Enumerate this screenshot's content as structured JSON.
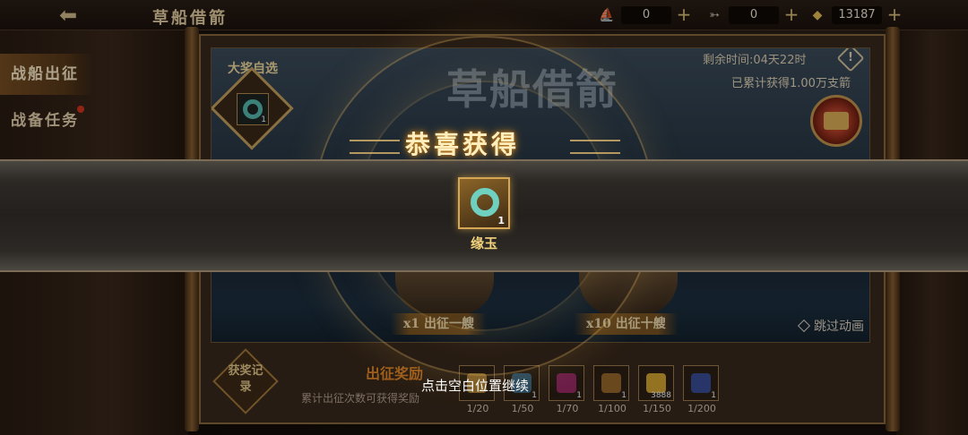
{
  "header": {
    "title": "草船借箭",
    "resources": [
      {
        "icon": "boat-icon",
        "value": "0"
      },
      {
        "icon": "arrow-bundle-icon",
        "value": "0"
      },
      {
        "icon": "gold-ingot-icon",
        "value": "13187"
      }
    ]
  },
  "sidebar": {
    "tabs": [
      {
        "label": "战船出征",
        "selected": true
      },
      {
        "label": "战备任务",
        "selected": false
      }
    ]
  },
  "event": {
    "banner_title": "草船借箭",
    "remaining_time": "剩余时间:04天22时",
    "accumulated": "已累计获得1.00万支箭",
    "grand_prize_label": "大奖自选",
    "grand_prize_count": "1",
    "launch_one": "x1 出征一艘",
    "launch_ten": "x10 出征十艘",
    "skip_animation": "跳过动画"
  },
  "rewards": {
    "record_label": "获奖记录",
    "title": "出征奖励",
    "description": "累计出征次数可获得奖励",
    "items": [
      {
        "progress": "1/20",
        "count": "",
        "color": "#b78a3a"
      },
      {
        "progress": "1/50",
        "count": "1",
        "color": "#3b6a8a"
      },
      {
        "progress": "1/70",
        "count": "1",
        "color": "#a02d6a"
      },
      {
        "progress": "1/100",
        "count": "1",
        "color": "#9a6a2a"
      },
      {
        "progress": "1/150",
        "count": "3888",
        "color": "#d9a932"
      },
      {
        "progress": "1/200",
        "count": "1",
        "color": "#3a4f9a"
      }
    ]
  },
  "popup": {
    "title": "恭喜获得",
    "item_name": "缘玉",
    "item_count": "1",
    "hint": "点击空白位置继续"
  }
}
